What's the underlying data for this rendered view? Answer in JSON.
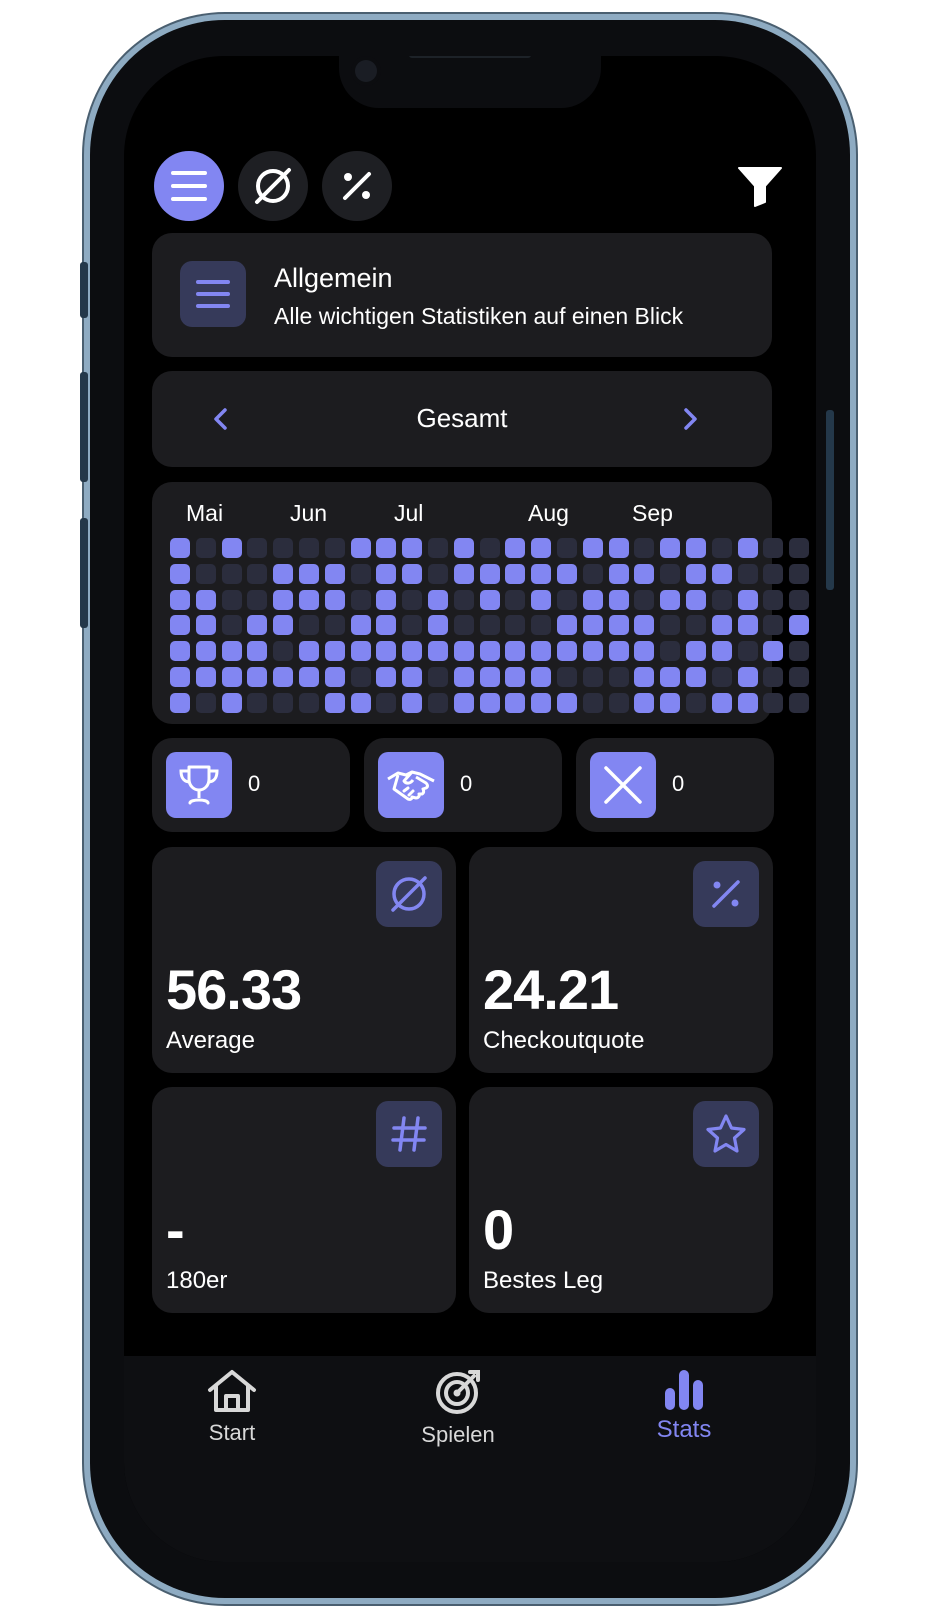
{
  "colors": {
    "accent": "#8286f2",
    "card": "#1c1c1f",
    "icon_bg": "#363a5a",
    "cell_off": "#2b2d3d"
  },
  "toolbar": {
    "buttons": [
      {
        "icon": "menu-icon",
        "active": true
      },
      {
        "icon": "average-icon",
        "active": false
      },
      {
        "icon": "percent-icon",
        "active": false
      }
    ],
    "filter_icon": "filter-icon"
  },
  "header": {
    "icon": "menu-icon",
    "title": "Allgemein",
    "subtitle": "Alle wichtigen Statistiken auf einen Blick"
  },
  "period": {
    "label": "Gesamt",
    "prev_icon": "chevron-left-icon",
    "next_icon": "chevron-right-icon"
  },
  "heatmap": {
    "months": [
      "Mai",
      "Jun",
      "Jul",
      "Aug",
      "Sep"
    ],
    "rows": [
      "1010000111010110110110100",
      "1000111011011111011011000",
      "1100111010101010110110100",
      "1101100110100001111001101",
      "1111011111111111111011010",
      "1111111011011110001110100",
      "1010001101011111001101100"
    ]
  },
  "results": [
    {
      "icon": "trophy-icon",
      "value": "0"
    },
    {
      "icon": "handshake-icon",
      "value": "0"
    },
    {
      "icon": "close-icon",
      "value": "0"
    }
  ],
  "stats": [
    {
      "icon": "average-icon",
      "value": "56.33",
      "label": "Average"
    },
    {
      "icon": "percent-icon",
      "value": "24.21",
      "label": "Checkoutquote"
    },
    {
      "icon": "hash-icon",
      "value": "-",
      "label": "180er"
    },
    {
      "icon": "star-icon",
      "value": "0",
      "label": "Bestes Leg"
    }
  ],
  "nav": {
    "items": [
      {
        "label": "Start",
        "icon": "home-icon",
        "active": false
      },
      {
        "label": "Spielen",
        "icon": "dartboard-icon",
        "active": false
      },
      {
        "label": "Stats",
        "icon": "bar-chart-icon",
        "active": true
      }
    ]
  }
}
